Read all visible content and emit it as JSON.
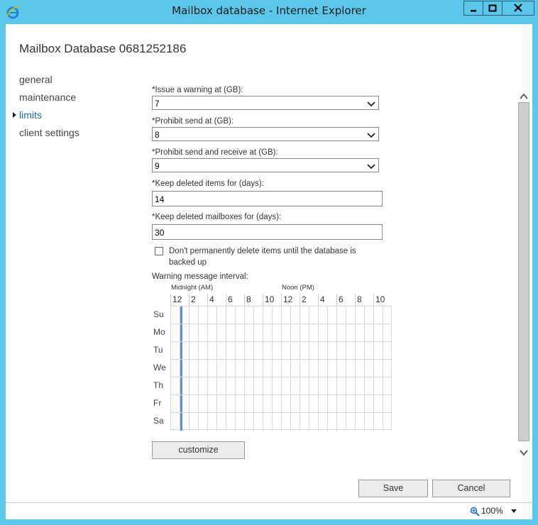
{
  "window": {
    "title": "Mailbox database - Internet Explorer",
    "controls": {
      "minimize_icon": "minimize-icon",
      "maximize_icon": "maximize-icon",
      "close_icon": "close-icon"
    }
  },
  "page": {
    "title": "Mailbox Database 0681252186"
  },
  "nav": {
    "items": [
      {
        "label": "general",
        "active": false
      },
      {
        "label": "maintenance",
        "active": false
      },
      {
        "label": "limits",
        "active": true
      },
      {
        "label": "client settings",
        "active": false
      }
    ]
  },
  "limits": {
    "warning": {
      "label": "*Issue a warning at (GB):",
      "value": "7"
    },
    "prohibit_send": {
      "label": "*Prohibit send at (GB):",
      "value": "8"
    },
    "prohibit_send_receive": {
      "label": "*Prohibit send and receive at (GB):",
      "value": "9"
    },
    "keep_deleted_items": {
      "label": "*Keep deleted items for (days):",
      "value": "14"
    },
    "keep_deleted_mailboxes": {
      "label": "*Keep deleted mailboxes for (days):",
      "value": "30"
    },
    "backup_checkbox": {
      "label": "Don't permanently delete items until the database is backed up",
      "checked": false
    },
    "warning_interval": {
      "label": "Warning message interval:",
      "am_label": "Midnight (AM)",
      "pm_label": "Noon (PM)",
      "hours": [
        "12",
        "2",
        "4",
        "6",
        "8",
        "10",
        "12",
        "2",
        "4",
        "6",
        "8",
        "10"
      ],
      "days": [
        "Su",
        "Mo",
        "Tu",
        "We",
        "Th",
        "Fr",
        "Sa"
      ],
      "selected_slot": "12:30 AM (every day)"
    },
    "customize_label": "customize"
  },
  "footer": {
    "save_label": "Save",
    "cancel_label": "Cancel"
  },
  "status": {
    "zoom": "100%"
  },
  "colors": {
    "chrome": "#5bc7ea",
    "accent": "#1a6fa3",
    "selection": "#5b8ee0"
  }
}
